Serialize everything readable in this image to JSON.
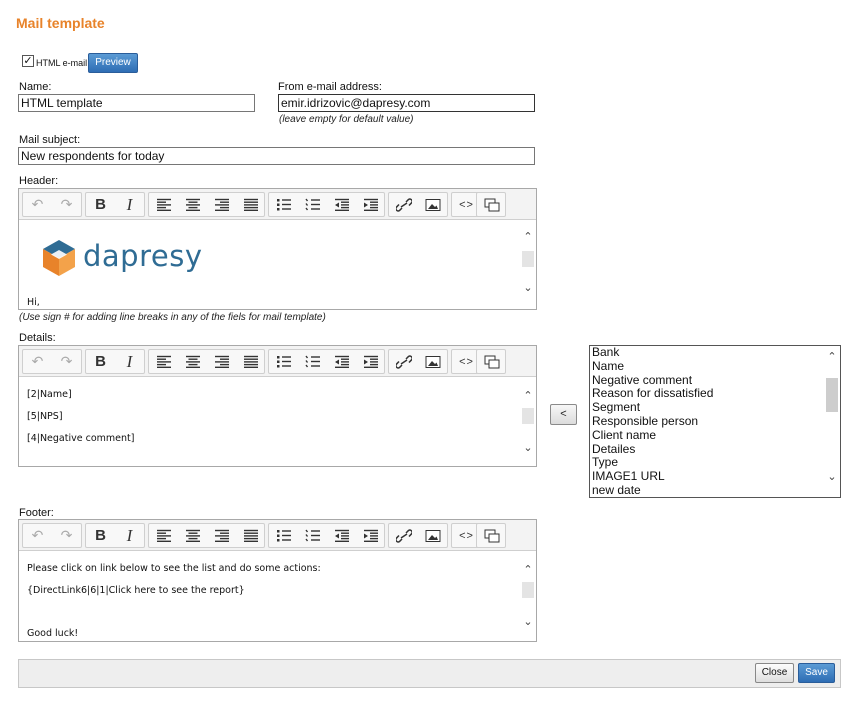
{
  "page_title": "Mail template",
  "html_email": {
    "label": "HTML e-mail",
    "checked": true,
    "check_glyph": "✓"
  },
  "preview_button": "Preview",
  "name": {
    "label": "Name:",
    "value": "HTML template"
  },
  "from_email": {
    "label": "From e-mail address:",
    "value": "emir.idrizovic@dapresy.com",
    "hint": "(leave empty for default value)"
  },
  "subject": {
    "label": "Mail subject:",
    "value": "New respondents for today"
  },
  "header_editor": {
    "label": "Header:",
    "logo_text": "dapresy",
    "lines": [
      "Hi,"
    ]
  },
  "line_break_hint": "(Use sign # for adding line breaks in any of the fiels for mail template)",
  "details_editor": {
    "label": "Details:",
    "lines": [
      "[2|Name]",
      "[5|NPS]",
      "[4|Negative comment]"
    ]
  },
  "footer_editor": {
    "label": "Footer:",
    "lines": [
      "Please click on link below to see the list and do some actions:",
      "{DirectLink6|6|1|Click here to see the report}",
      "Good luck!"
    ]
  },
  "toolbar_icons": [
    "undo-icon",
    "redo-icon",
    "bold-icon",
    "italic-icon",
    "align-left-icon",
    "align-center-icon",
    "align-right-icon",
    "justify-icon",
    "bullet-list-icon",
    "numbered-list-icon",
    "outdent-icon",
    "indent-icon",
    "link-icon",
    "image-icon",
    "source-code-icon",
    "clear-format-icon"
  ],
  "toolbar_glyphs": {
    "undo": "↶",
    "redo": "↷",
    "bold": "B",
    "italic": "I",
    "code": "<>"
  },
  "insert_button": "<",
  "fields_list": [
    "Bank",
    "Name",
    "Negative comment",
    "Reason for dissatisfied",
    "Segment",
    "Responsible person",
    "Client name",
    "Detailes",
    "Type",
    "IMAGE1 URL",
    "new date"
  ],
  "scroll_glyphs": {
    "up": "⌃",
    "down": "⌄"
  },
  "buttons": {
    "close": "Close",
    "save": "Save"
  },
  "colors": {
    "title": "#e8832a",
    "primary_button": "#2e6db4",
    "logo_orange": "#e8832a",
    "logo_blue": "#2f6c94"
  }
}
